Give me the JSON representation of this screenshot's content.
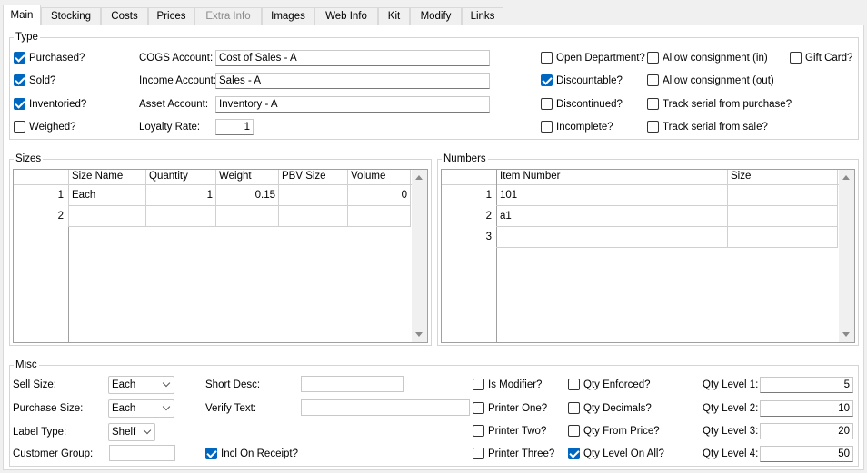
{
  "tabs": [
    "Main",
    "Stocking",
    "Costs",
    "Prices",
    "Extra Info",
    "Images",
    "Web Info",
    "Kit",
    "Modify",
    "Links"
  ],
  "type_group": {
    "title": "Type",
    "purchased": {
      "label": "Purchased?",
      "checked": true
    },
    "sold": {
      "label": "Sold?",
      "checked": true
    },
    "inventoried": {
      "label": "Inventoried?",
      "checked": true
    },
    "weighed": {
      "label": "Weighed?",
      "checked": false
    },
    "cogs_label": "COGS Account:",
    "cogs_value": "Cost of Sales - A",
    "income_label": "Income Account:",
    "income_value": "Sales - A",
    "asset_label": "Asset Account:",
    "asset_value": "Inventory - A",
    "loyalty_label": "Loyalty Rate:",
    "loyalty_value": "1",
    "open_department": {
      "label": "Open Department?",
      "checked": false
    },
    "discountable": {
      "label": "Discountable?",
      "checked": true
    },
    "discontinued": {
      "label": "Discontinued?",
      "checked": false
    },
    "incomplete": {
      "label": "Incomplete?",
      "checked": false
    },
    "consign_in": {
      "label": "Allow consignment (in)",
      "checked": false
    },
    "consign_out": {
      "label": "Allow consignment (out)",
      "checked": false
    },
    "serial_purchase": {
      "label": "Track serial from purchase?",
      "checked": false
    },
    "serial_sale": {
      "label": "Track serial from sale?",
      "checked": false
    },
    "gift_card": {
      "label": "Gift Card?",
      "checked": false
    }
  },
  "sizes": {
    "title": "Sizes",
    "columns": [
      "Size Name",
      "Quantity",
      "Weight",
      "PBV Size",
      "Volume"
    ],
    "rows": [
      {
        "num": "1",
        "name": "Each",
        "qty": "1",
        "weight": "0.15",
        "pbv": "",
        "volume": "0"
      },
      {
        "num": "2",
        "name": "",
        "qty": "",
        "weight": "",
        "pbv": "",
        "volume": ""
      }
    ]
  },
  "numbers": {
    "title": "Numbers",
    "columns": [
      "Item Number",
      "Size"
    ],
    "rows": [
      {
        "num": "1",
        "item": "101",
        "size": ""
      },
      {
        "num": "2",
        "item": "a1",
        "size": ""
      },
      {
        "num": "3",
        "item": "",
        "size": ""
      }
    ]
  },
  "misc": {
    "title": "Misc",
    "sell_size_label": "Sell Size:",
    "sell_size_value": "Each",
    "purchase_size_label": "Purchase Size:",
    "purchase_size_value": "Each",
    "label_type_label": "Label Type:",
    "label_type_value": "Shelf",
    "customer_group_label": "Customer Group:",
    "short_desc_label": "Short Desc:",
    "verify_text_label": "Verify Text:",
    "incl_on_receipt": {
      "label": "Incl On Receipt?",
      "checked": true
    },
    "is_modifier": {
      "label": "Is Modifier?",
      "checked": false
    },
    "printer_one": {
      "label": "Printer One?",
      "checked": false
    },
    "printer_two": {
      "label": "Printer Two?",
      "checked": false
    },
    "printer_three": {
      "label": "Printer Three?",
      "checked": false
    },
    "qty_enforced": {
      "label": "Qty Enforced?",
      "checked": false
    },
    "qty_decimals": {
      "label": "Qty Decimals?",
      "checked": false
    },
    "qty_from_price": {
      "label": "Qty From Price?",
      "checked": false
    },
    "qty_level_on_all": {
      "label": "Qty Level On All?",
      "checked": true
    },
    "qty_level_1_label": "Qty Level 1:",
    "qty_level_1": "5",
    "qty_level_2_label": "Qty Level 2:",
    "qty_level_2": "10",
    "qty_level_3_label": "Qty Level 3:",
    "qty_level_3": "20",
    "qty_level_4_label": "Qty Level 4:",
    "qty_level_4": "50"
  }
}
